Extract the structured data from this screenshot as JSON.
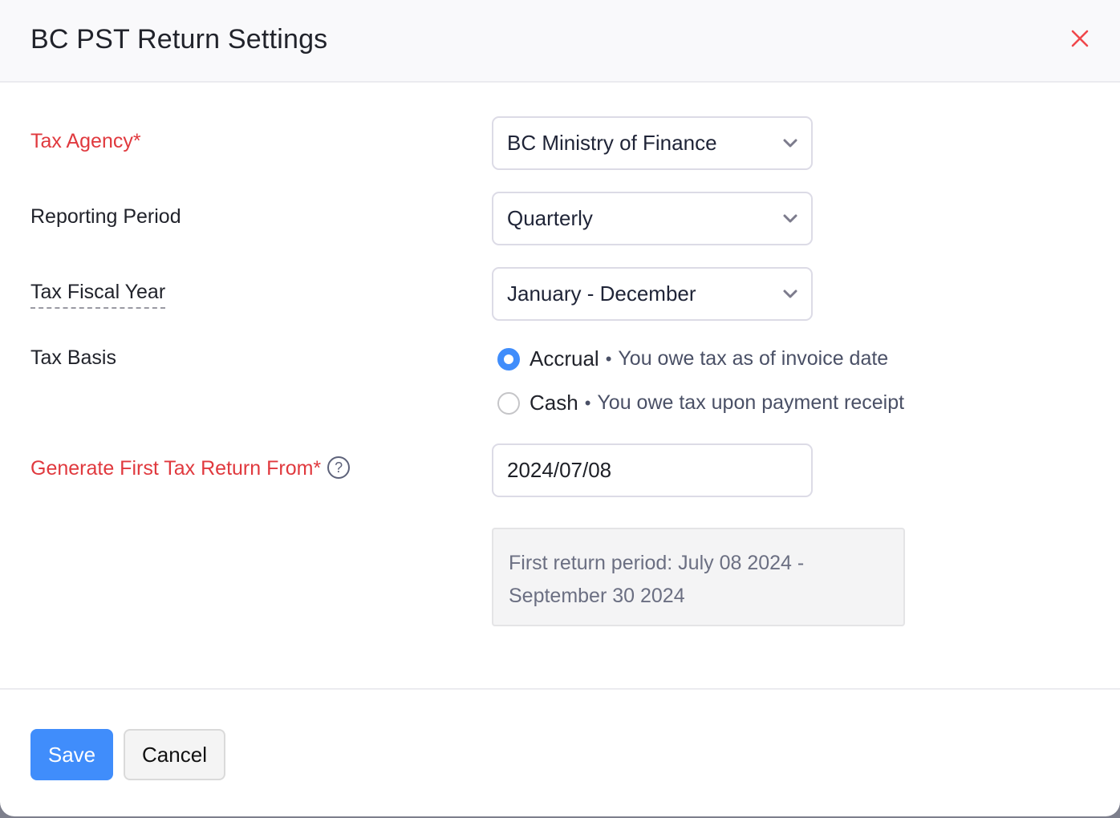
{
  "dialog": {
    "title": "BC PST Return Settings",
    "close_icon": "close-x-icon",
    "close_color": "#e0393e"
  },
  "form": {
    "tax_agency": {
      "label": "Tax Agency*",
      "required": true,
      "value": "BC Ministry of Finance"
    },
    "reporting_period": {
      "label": "Reporting Period",
      "value": "Quarterly"
    },
    "tax_fiscal_year": {
      "label": "Tax Fiscal Year",
      "value": "January - December"
    },
    "tax_basis": {
      "label": "Tax Basis",
      "options": [
        {
          "label": "Accrual",
          "separator": "•",
          "description": "You owe tax as of invoice date",
          "checked": true
        },
        {
          "label": "Cash",
          "separator": "•",
          "description": "You owe tax upon payment receipt",
          "checked": false
        }
      ]
    },
    "first_return_from": {
      "label": "Generate First Tax Return From*",
      "required": true,
      "help_icon": "?",
      "value": "2024/07/08"
    },
    "first_return_period_info": {
      "line1": "First return period: July 08 2024 -",
      "line2": "September 30 2024"
    }
  },
  "footer": {
    "save_label": "Save",
    "cancel_label": "Cancel"
  },
  "colors": {
    "accent": "#408dfb",
    "required": "#e0393e",
    "text": "#21232b",
    "muted": "#6b6f82"
  }
}
